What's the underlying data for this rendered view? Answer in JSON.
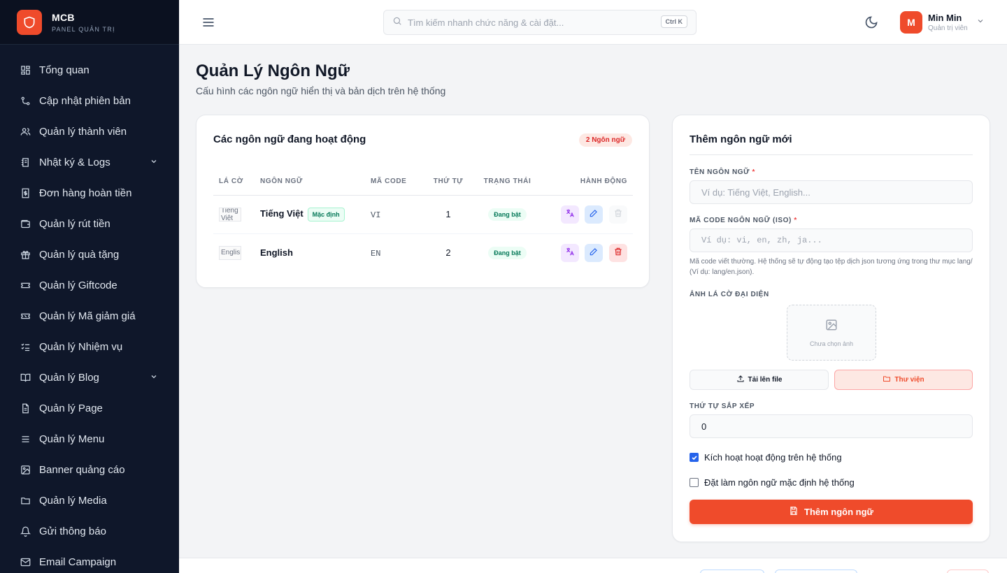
{
  "brand": {
    "name": "MCB",
    "subtitle": "PANEL QUẢN TRỊ",
    "icon": "shield-icon",
    "color": "#ef4b2b"
  },
  "sidebar": {
    "items": [
      {
        "label": "Tổng quan",
        "icon": "dashboard-icon"
      },
      {
        "label": "Cập nhật phiên bản",
        "icon": "git-branch-icon"
      },
      {
        "label": "Quản lý thành viên",
        "icon": "users-icon"
      },
      {
        "label": "Nhật ký & Logs",
        "icon": "log-icon",
        "expandable": true
      },
      {
        "label": "Đơn hàng hoàn tiền",
        "icon": "refund-icon"
      },
      {
        "label": "Quản lý rút tiền",
        "icon": "wallet-icon"
      },
      {
        "label": "Quản lý quà tặng",
        "icon": "gift-icon"
      },
      {
        "label": "Quản lý Giftcode",
        "icon": "ticket-icon"
      },
      {
        "label": "Quản lý Mã giảm giá",
        "icon": "coupon-icon"
      },
      {
        "label": "Quản lý Nhiệm vụ",
        "icon": "checklist-icon"
      },
      {
        "label": "Quản lý Blog",
        "icon": "book-icon",
        "expandable": true
      },
      {
        "label": "Quản lý Page",
        "icon": "file-icon"
      },
      {
        "label": "Quản lý Menu",
        "icon": "menu-icon"
      },
      {
        "label": "Banner quảng cáo",
        "icon": "image-icon"
      },
      {
        "label": "Quản lý Media",
        "icon": "folder-icon"
      },
      {
        "label": "Gửi thông báo",
        "icon": "bell-icon"
      },
      {
        "label": "Email Campaign",
        "icon": "mail-icon"
      }
    ]
  },
  "topbar": {
    "search_placeholder": "Tìm kiếm nhanh chức năng & cài đặt...",
    "shortcut": "Ctrl K",
    "user": {
      "initial": "M",
      "name": "Min Min",
      "role": "Quản trị viên"
    }
  },
  "page": {
    "title": "Quản Lý Ngôn Ngữ",
    "subtitle": "Cấu hình các ngôn ngữ hiển thị và bản dịch trên hệ thống"
  },
  "languages": {
    "title": "Các ngôn ngữ đang hoạt động",
    "count_badge": "2 Ngôn ngữ",
    "columns": [
      "LÁ CỜ",
      "NGÔN NGỮ",
      "MÃ CODE",
      "THỨ TỰ",
      "TRẠNG THÁI",
      "HÀNH ĐỘNG"
    ],
    "rows": [
      {
        "flag_alt": "Tiếng Việt",
        "name": "Tiếng Việt",
        "default_badge": "Mặc định",
        "code": "VI",
        "order": "1",
        "status": "Đang bật",
        "delete_disabled": true
      },
      {
        "flag_alt": "English",
        "name": "English",
        "default_badge": "",
        "code": "EN",
        "order": "2",
        "status": "Đang bật",
        "delete_disabled": false
      }
    ]
  },
  "form": {
    "title": "Thêm ngôn ngữ mới",
    "name_label": "TÊN NGÔN NGỮ",
    "name_placeholder": "Ví dụ: Tiếng Việt, English...",
    "code_label": "MÃ CODE NGÔN NGỮ (ISO)",
    "code_placeholder": "Ví dụ: vi, en, zh, ja...",
    "code_help": "Mã code viết thường. Hệ thống sẽ tự động tạo tệp dịch json tương ứng trong thư mục lang/ (Ví dụ: lang/en.json).",
    "flag_label": "ẢNH LÁ CỜ ĐẠI DIỆN",
    "flag_empty": "Chưa chọn ảnh",
    "upload_label": "Tải lên file",
    "library_label": "Thư viện",
    "order_label": "THỨ TỰ SẮP XẾP",
    "order_value": "0",
    "active_label": "Kích hoạt hoạt động trên hệ thống",
    "active_checked": true,
    "default_label": "Đặt làm ngôn ngữ mặc định hệ thống",
    "default_checked": false,
    "submit_label": "Thêm ngôn ngữ",
    "required_mark": "*"
  }
}
